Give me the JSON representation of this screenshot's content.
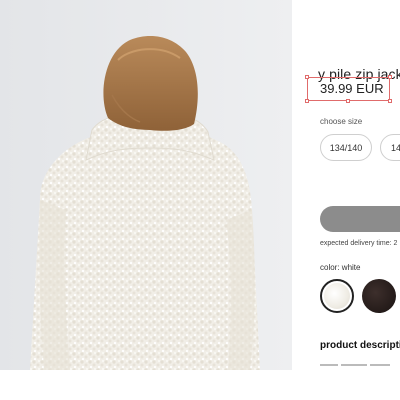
{
  "product": {
    "title": "y pile zip jack",
    "price": "39.99 EUR",
    "size_label": "choose size",
    "sizes": [
      "134/140",
      "14("
    ],
    "delivery_text": "expected delivery time: 2",
    "color_label": "color: white",
    "colors": [
      {
        "name": "white",
        "hex": "#f1eee7",
        "selected": true
      },
      {
        "name": "dark-brown",
        "hex": "#261c1a",
        "selected": false
      }
    ],
    "description_heading": "product description",
    "add_button_color": "#8c8c8c"
  },
  "annotation": {
    "color": "#e06b6b"
  },
  "photo": {
    "subject": "model-wearing-white-teddy-jacket"
  }
}
